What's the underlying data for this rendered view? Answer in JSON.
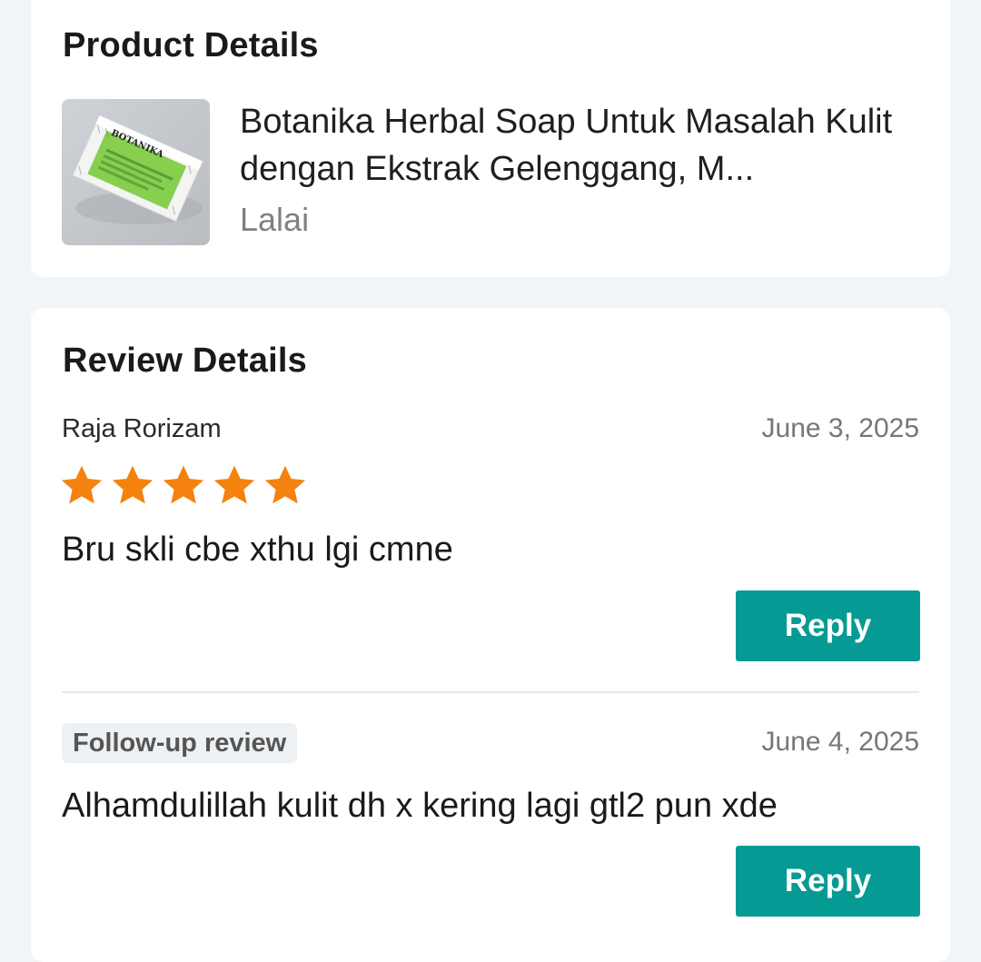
{
  "product_section": {
    "title": "Product Details",
    "product": {
      "name": "Botanika Herbal Soap Untuk Masalah Kulit dengan Ekstrak Gelenggang, M...",
      "variant": "Lalai",
      "thumbnail_label": "BOTANIKA"
    }
  },
  "review_section": {
    "title": "Review Details",
    "reviewer": "Raja Rorizam",
    "date": "June 3, 2025",
    "rating": 5,
    "star_color": "#f5820e",
    "text": "Bru skli cbe xthu lgi cmne",
    "reply_label": "Reply",
    "followup": {
      "tag": "Follow-up review",
      "date": "June 4, 2025",
      "text": "Alhamdulillah kulit dh x kering lagi gtl2 pun xde",
      "reply_label": "Reply"
    }
  },
  "colors": {
    "accent": "#069a95",
    "background": "#f2f5f8"
  }
}
